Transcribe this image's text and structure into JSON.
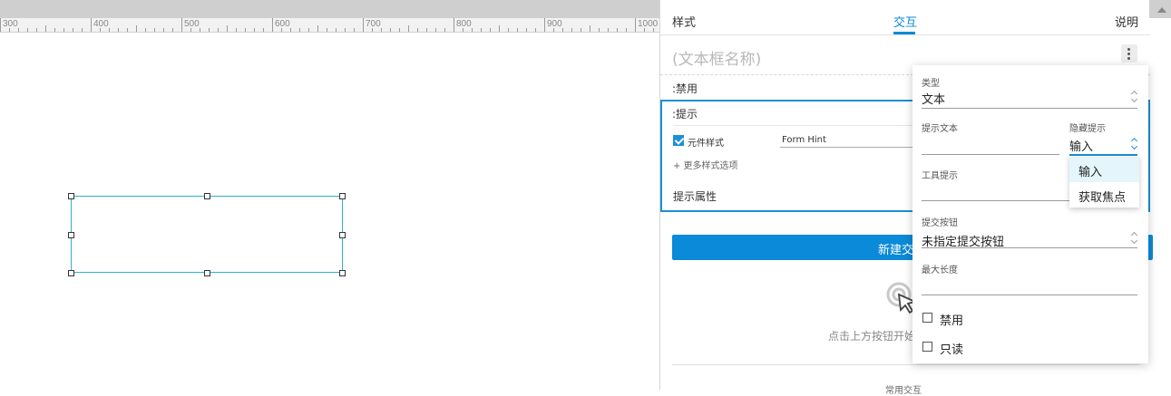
{
  "ruler": {
    "labels": [
      "300",
      "400",
      "500",
      "600",
      "700",
      "800",
      "900",
      "1000"
    ]
  },
  "panel": {
    "tabs": [
      {
        "label": "样式"
      },
      {
        "label": "交互",
        "active": true
      },
      {
        "label": "说明"
      }
    ],
    "name_placeholder": "(文本框名称)",
    "disabled_label": ":禁用",
    "hint_label": ":提示",
    "widget_style_label": "元件样式",
    "widget_style_value": "Form Hint",
    "more_styles_link": "+ 更多样式选项",
    "hint_props_label": "提示属性",
    "new_interaction_button": "新建交",
    "empty_hint": "点击上方按钮开始",
    "common_interactions": "常用交互"
  },
  "popup": {
    "type_label": "类型",
    "type_value": "文本",
    "hint_text_label": "提示文本",
    "hint_text_value": "",
    "hide_hint_label": "隐藏提示",
    "hide_hint_value": "输入",
    "tooltip_label": "工具提示",
    "tooltip_value": "",
    "submit_label": "提交按钮",
    "submit_value": "未指定提交按钮",
    "maxlen_label": "最大长度",
    "maxlen_value": "",
    "disabled_checkbox": "禁用",
    "readonly_checkbox": "只读"
  },
  "dropdown": {
    "options": [
      "输入",
      "获取焦点"
    ],
    "highlighted": "输入"
  },
  "colors": {
    "accent": "#0a8ad8",
    "selection": "#2bb3c9",
    "dropdown_highlight": "#e4f5fb"
  },
  "icons": [
    "kebab-menu-icon",
    "up-down-arrow-icon",
    "check-icon",
    "click-pointer-icon",
    "scroll-up-icon"
  ]
}
